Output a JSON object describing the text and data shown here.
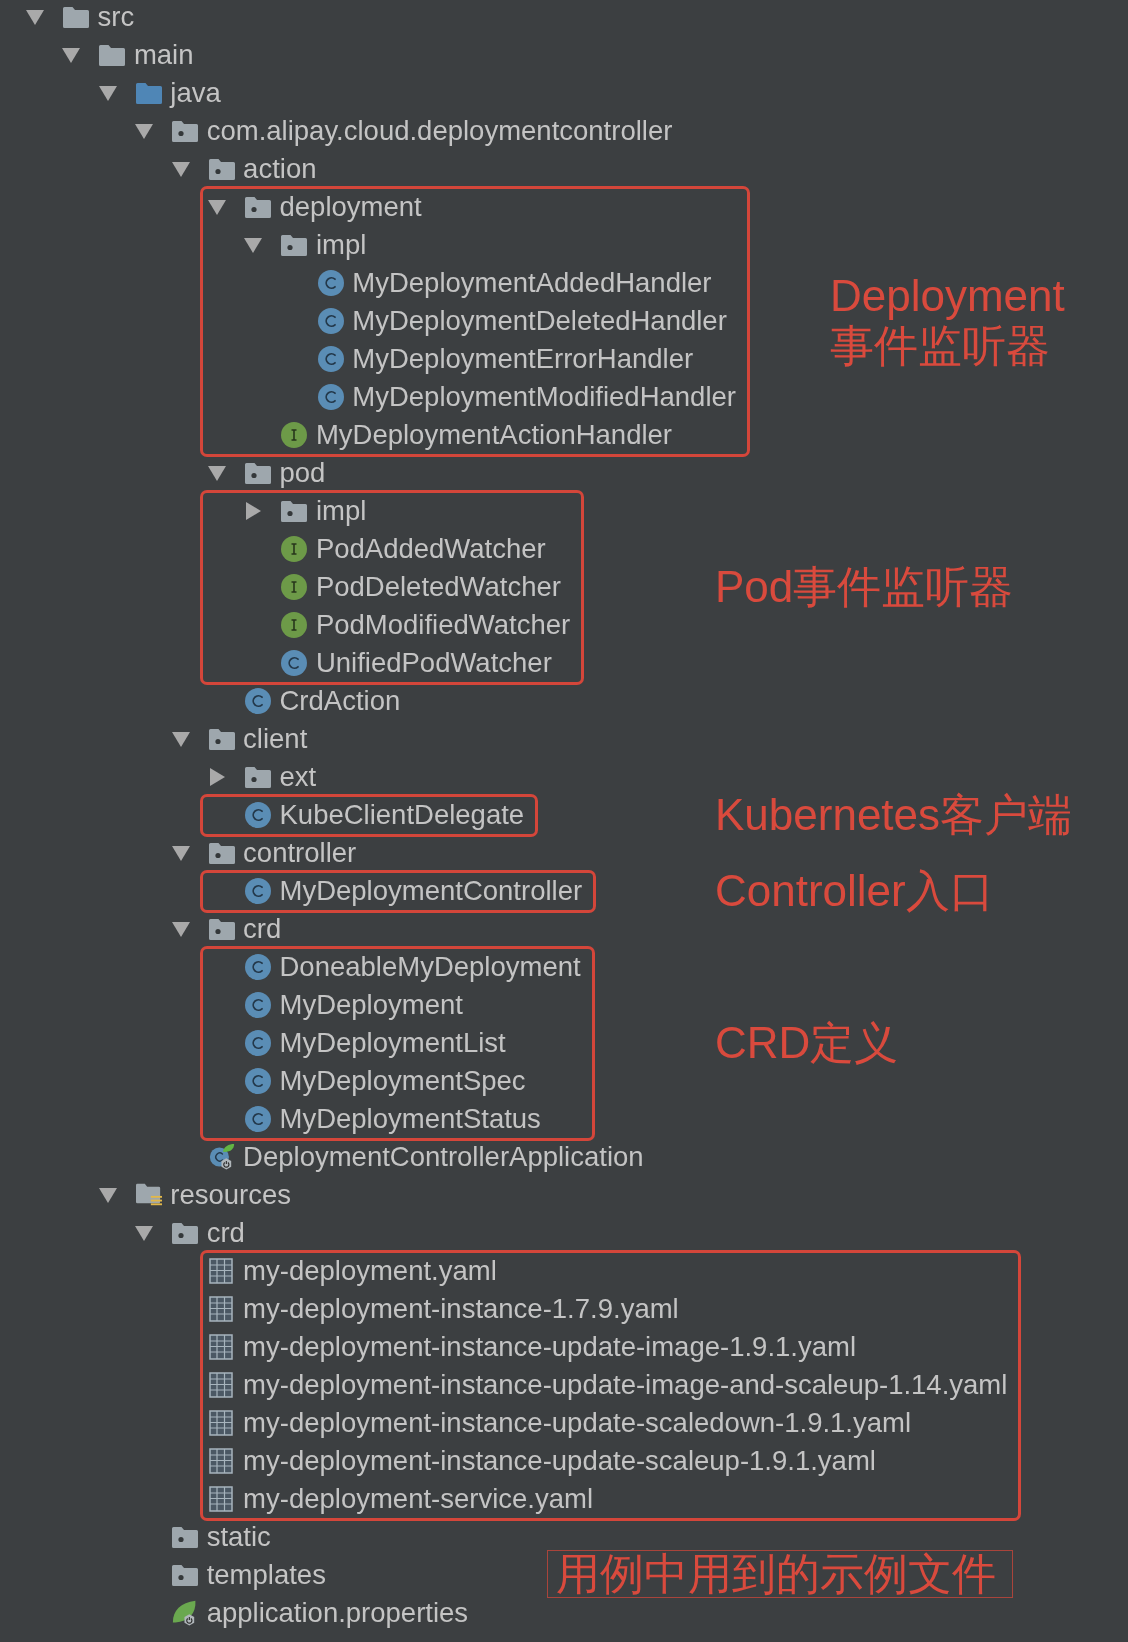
{
  "tree": [
    {
      "name": "src",
      "kind": "folder",
      "expanded": true,
      "children": [
        {
          "name": "main",
          "kind": "folder",
          "expanded": true,
          "children": [
            {
              "name": "java",
              "kind": "sourceroot",
              "expanded": true,
              "children": [
                {
                  "name": "com.alipay.cloud.deploymentcontroller",
                  "kind": "package",
                  "expanded": true,
                  "children": [
                    {
                      "name": "action",
                      "kind": "package",
                      "expanded": true,
                      "children": [
                        {
                          "name": "deployment",
                          "kind": "package",
                          "expanded": true,
                          "framed": true,
                          "children": [
                            {
                              "name": "impl",
                              "kind": "package",
                              "expanded": true,
                              "children": [
                                {
                                  "name": "MyDeploymentAddedHandler",
                                  "kind": "class"
                                },
                                {
                                  "name": "MyDeploymentDeletedHandler",
                                  "kind": "class"
                                },
                                {
                                  "name": "MyDeploymentErrorHandler",
                                  "kind": "class"
                                },
                                {
                                  "name": "MyDeploymentModifiedHandler",
                                  "kind": "class"
                                }
                              ]
                            },
                            {
                              "name": "MyDeploymentActionHandler",
                              "kind": "interface"
                            }
                          ]
                        },
                        {
                          "name": "pod",
                          "kind": "package",
                          "expanded": true,
                          "children": [
                            {
                              "name": "impl",
                              "kind": "package",
                              "expanded": false,
                              "framed": true
                            },
                            {
                              "name": "PodAddedWatcher",
                              "kind": "interface",
                              "framed": true
                            },
                            {
                              "name": "PodDeletedWatcher",
                              "kind": "interface",
                              "framed": true
                            },
                            {
                              "name": "PodModifiedWatcher",
                              "kind": "interface",
                              "framed": true
                            },
                            {
                              "name": "UnifiedPodWatcher",
                              "kind": "class",
                              "framed": true
                            }
                          ]
                        },
                        {
                          "name": "CrdAction",
                          "kind": "class"
                        }
                      ]
                    },
                    {
                      "name": "client",
                      "kind": "package",
                      "expanded": true,
                      "children": [
                        {
                          "name": "ext",
                          "kind": "package",
                          "expanded": false
                        },
                        {
                          "name": "KubeClientDelegate",
                          "kind": "class",
                          "framed": true
                        }
                      ]
                    },
                    {
                      "name": "controller",
                      "kind": "package",
                      "expanded": true,
                      "children": [
                        {
                          "name": "MyDeploymentController",
                          "kind": "class",
                          "framed": true
                        }
                      ]
                    },
                    {
                      "name": "crd",
                      "kind": "package",
                      "expanded": true,
                      "children": [
                        {
                          "name": "DoneableMyDeployment",
                          "kind": "class",
                          "framed": true
                        },
                        {
                          "name": "MyDeployment",
                          "kind": "class",
                          "framed": true
                        },
                        {
                          "name": "MyDeploymentList",
                          "kind": "class",
                          "framed": true
                        },
                        {
                          "name": "MyDeploymentSpec",
                          "kind": "class",
                          "framed": true
                        },
                        {
                          "name": "MyDeploymentStatus",
                          "kind": "class",
                          "framed": true
                        }
                      ]
                    },
                    {
                      "name": "DeploymentControllerApplication",
                      "kind": "application"
                    }
                  ]
                }
              ]
            },
            {
              "name": "resources",
              "kind": "resources",
              "expanded": true,
              "children": [
                {
                  "name": "crd",
                  "kind": "package",
                  "expanded": true,
                  "children": [
                    {
                      "name": "my-deployment.yaml",
                      "kind": "yaml",
                      "framed": true
                    },
                    {
                      "name": "my-deployment-instance-1.7.9.yaml",
                      "kind": "yaml",
                      "framed": true
                    },
                    {
                      "name": "my-deployment-instance-update-image-1.9.1.yaml",
                      "kind": "yaml",
                      "framed": true
                    },
                    {
                      "name": "my-deployment-instance-update-image-and-scaleup-1.14.yaml",
                      "kind": "yaml",
                      "framed": true
                    },
                    {
                      "name": "my-deployment-instance-update-scaledown-1.9.1.yaml",
                      "kind": "yaml",
                      "framed": true
                    },
                    {
                      "name": "my-deployment-instance-update-scaleup-1.9.1.yaml",
                      "kind": "yaml",
                      "framed": true
                    },
                    {
                      "name": "my-deployment-service.yaml",
                      "kind": "yaml",
                      "framed": true
                    }
                  ]
                },
                {
                  "name": "static",
                  "kind": "package"
                },
                {
                  "name": "templates",
                  "kind": "package"
                },
                {
                  "name": "application.properties",
                  "kind": "properties"
                }
              ]
            }
          ]
        }
      ]
    }
  ],
  "annotations": [
    {
      "text": "Deployment事件监听器",
      "kind": "side"
    },
    {
      "text": "Pod事件监听器",
      "kind": "side"
    },
    {
      "text": "Kubernetes客户端",
      "kind": "side"
    },
    {
      "text": "Controller入口",
      "kind": "side"
    },
    {
      "text": "CRD定义",
      "kind": "side"
    },
    {
      "text": "用例中用到的示例文件",
      "kind": "caption"
    }
  ]
}
